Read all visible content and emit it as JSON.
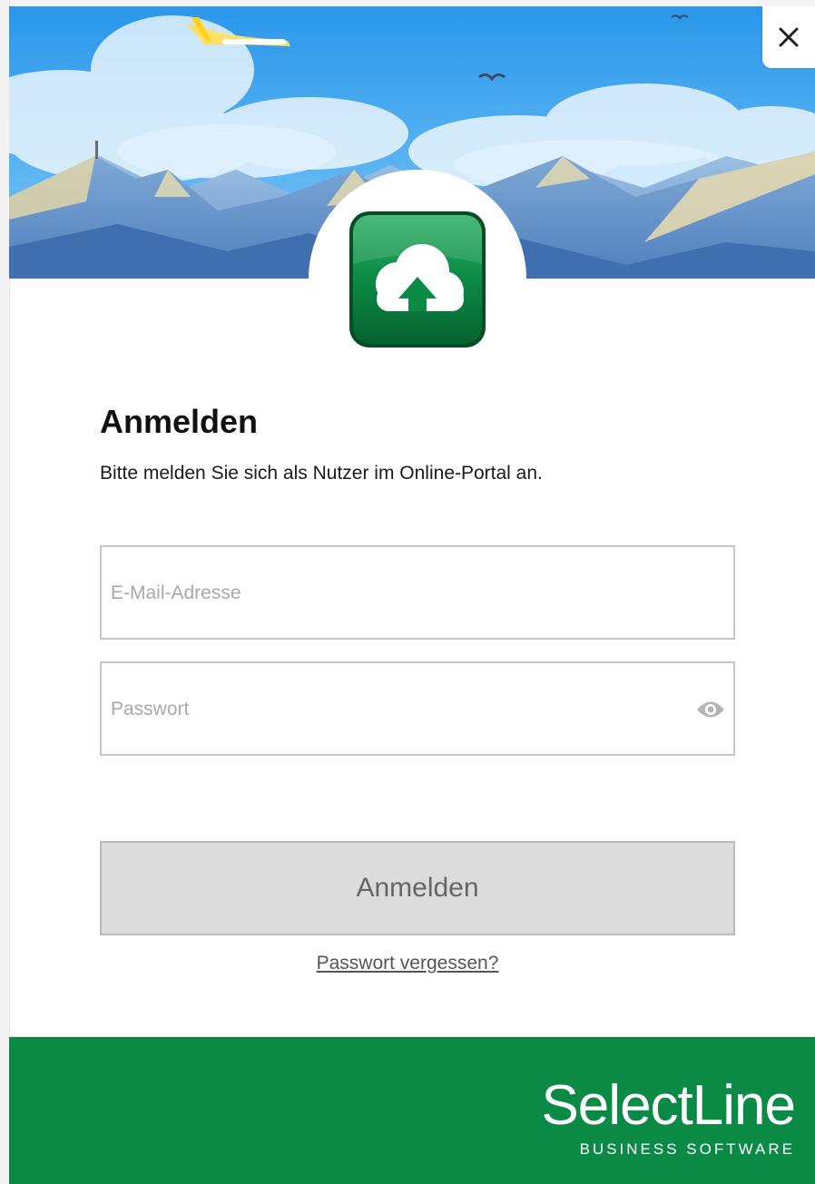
{
  "dialog": {
    "close_icon": "close-icon",
    "heading": "Anmelden",
    "subtitle": "Bitte melden Sie sich als Nutzer im Online-Portal an."
  },
  "form": {
    "email_placeholder": "E-Mail-Adresse",
    "email_value": "",
    "password_placeholder": "Passwort",
    "password_value": "",
    "password_toggle_icon": "eye-icon",
    "submit_label": "Anmelden",
    "forgot_label": "Passwort vergessen?"
  },
  "footer": {
    "brand_name": "SelectLine",
    "brand_tagline": "BUSINESS SOFTWARE"
  },
  "colors": {
    "brand_green": "#0b8a45",
    "icon_green": "#0a7a3a",
    "button_disabled_bg": "#dcdcdc",
    "sky_blue": "#3fa9f5"
  }
}
